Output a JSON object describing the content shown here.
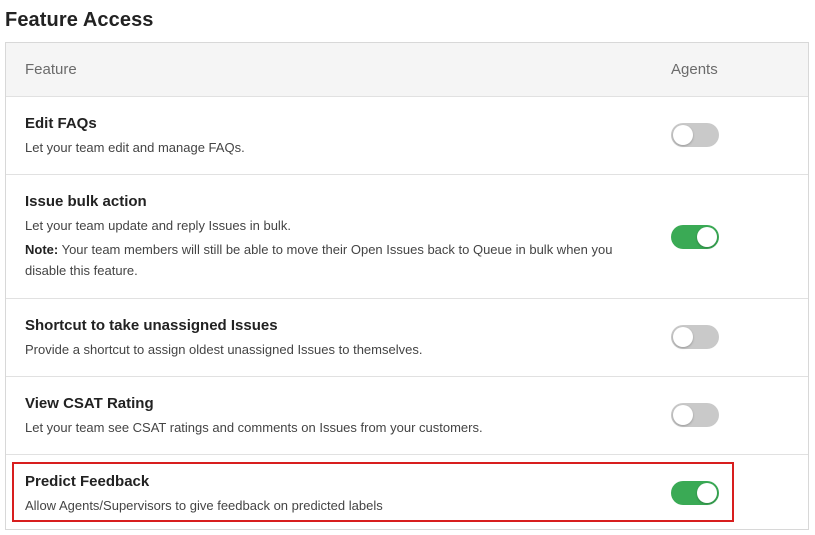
{
  "page": {
    "title": "Feature Access"
  },
  "table": {
    "headers": {
      "feature": "Feature",
      "agents": "Agents"
    },
    "rows": [
      {
        "title": "Edit FAQs",
        "description": "Let your team edit and manage FAQs.",
        "enabled": false
      },
      {
        "title": "Issue bulk action",
        "description": "Let your team update and reply Issues in bulk.",
        "note_label": "Note:",
        "note_text": " Your team members will still be able to move their Open Issues back to Queue in bulk when you disable this feature.",
        "enabled": true
      },
      {
        "title": "Shortcut to take unassigned Issues",
        "description": "Provide a shortcut to assign oldest unassigned Issues to themselves.",
        "enabled": false
      },
      {
        "title": "View CSAT Rating",
        "description": "Let your team see CSAT ratings and comments on Issues from your customers.",
        "enabled": false
      },
      {
        "title": "Predict Feedback",
        "description": "Allow Agents/Supervisors to give feedback on predicted labels",
        "enabled": true,
        "highlighted": true
      }
    ]
  },
  "colors": {
    "toggle_on": "#3aaa55",
    "toggle_off": "#c9c9c9",
    "highlight": "#d81e1e"
  }
}
